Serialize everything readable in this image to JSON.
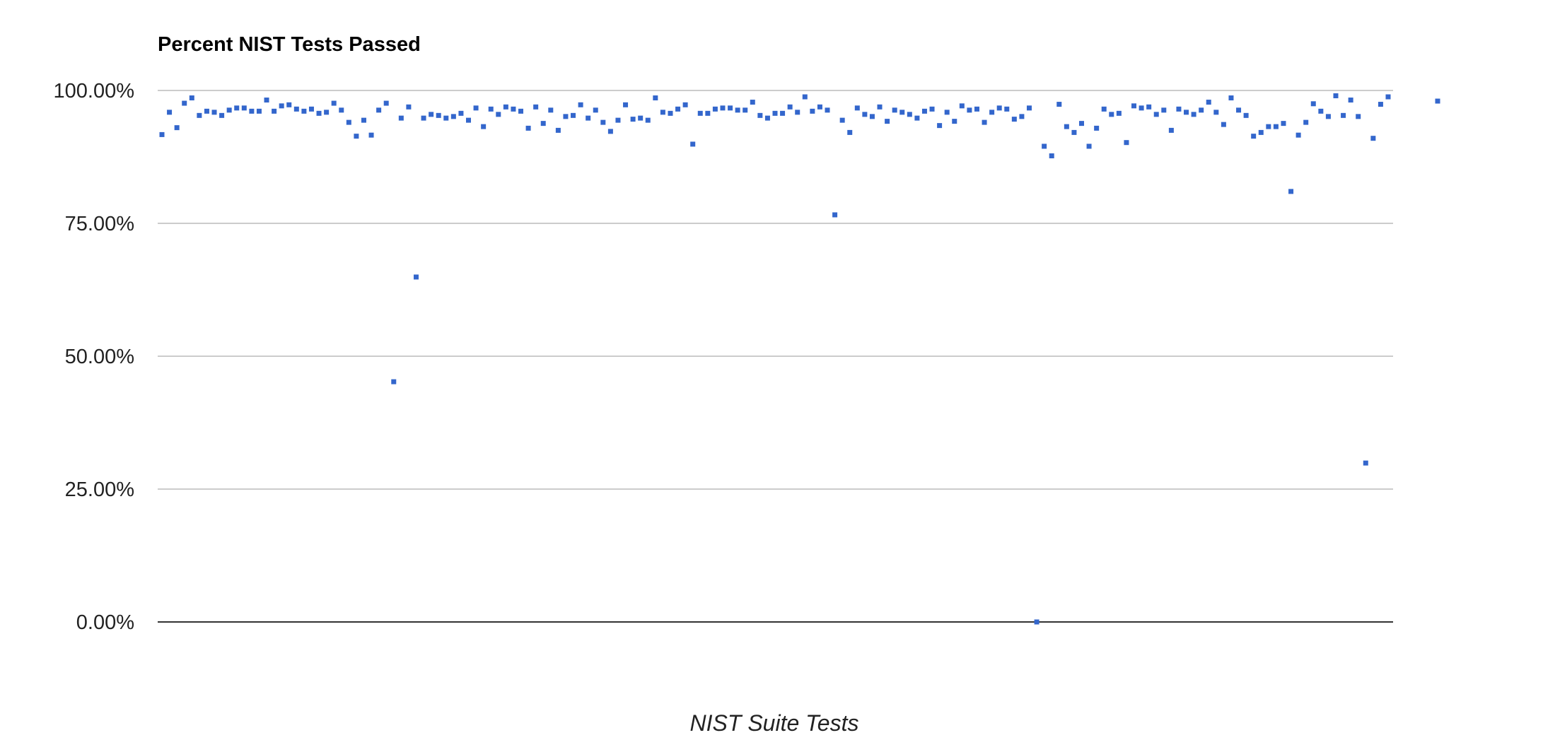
{
  "chart_data": {
    "type": "scatter",
    "title": "Percent NIST Tests Passed",
    "xlabel": "NIST Suite Tests",
    "ylabel": "",
    "x_axis_visible_labels": false,
    "ylim": [
      0,
      100
    ],
    "y_ticks": [
      0,
      25,
      50,
      75,
      100
    ],
    "y_tick_labels": [
      "0.00%",
      "25.00%",
      "50.00%",
      "75.00%",
      "100.00%"
    ],
    "grid": true,
    "legend": "none",
    "colors": {
      "points": "#3366cc",
      "grid": "#cccccc",
      "baseline": "#333333"
    },
    "series": [
      {
        "values": [
          91.7,
          95.9,
          93.0,
          97.6,
          98.6,
          95.3,
          96.1,
          95.9,
          95.3,
          96.3,
          96.7,
          96.7,
          96.1,
          96.1,
          98.2,
          96.1,
          97.1,
          97.3,
          96.5,
          96.1,
          96.5,
          95.7,
          95.9,
          97.6,
          96.3,
          94.0,
          91.4,
          94.4,
          91.6,
          96.3,
          97.6,
          45.2,
          94.8,
          96.9,
          64.9,
          94.8,
          95.5,
          95.3,
          94.8,
          95.1,
          95.7,
          94.4,
          96.7,
          93.2,
          96.5,
          95.5,
          96.9,
          96.5,
          96.1,
          92.9,
          96.9,
          93.8,
          96.3,
          92.5,
          95.1,
          95.3,
          97.3,
          94.8,
          96.3,
          94.0,
          92.3,
          94.4,
          97.3,
          94.6,
          94.8,
          94.4,
          98.6,
          95.9,
          95.7,
          96.5,
          97.3,
          89.9,
          95.7,
          95.7,
          96.5,
          96.7,
          96.7,
          96.3,
          96.3,
          97.8,
          95.3,
          94.8,
          95.7,
          95.7,
          96.9,
          95.9,
          98.8,
          96.1,
          96.9,
          96.3,
          76.6,
          94.4,
          92.1,
          96.7,
          95.5,
          95.1,
          96.9,
          94.2,
          96.3,
          95.9,
          95.5,
          94.8,
          96.1,
          96.5,
          93.4,
          95.9,
          94.2,
          97.1,
          96.3,
          96.5,
          94.0,
          95.9,
          96.7,
          96.5,
          94.6,
          95.1,
          96.7,
          0.0,
          89.5,
          87.7,
          97.4,
          93.2,
          92.1,
          93.8,
          89.5,
          92.9,
          96.5,
          95.5,
          95.7,
          90.2,
          97.1,
          96.7,
          96.9,
          95.5,
          96.3,
          92.5,
          96.5,
          95.9,
          95.5,
          96.3,
          97.8,
          95.9,
          93.6,
          98.6,
          96.3,
          95.3,
          91.4,
          92.1,
          93.2,
          93.2,
          93.8,
          81.0,
          91.6,
          94.0,
          97.5,
          96.1,
          95.1,
          99.0,
          95.3,
          98.2,
          95.1,
          29.9,
          91.0,
          97.4,
          98.8,
          98.0
        ]
      }
    ]
  }
}
